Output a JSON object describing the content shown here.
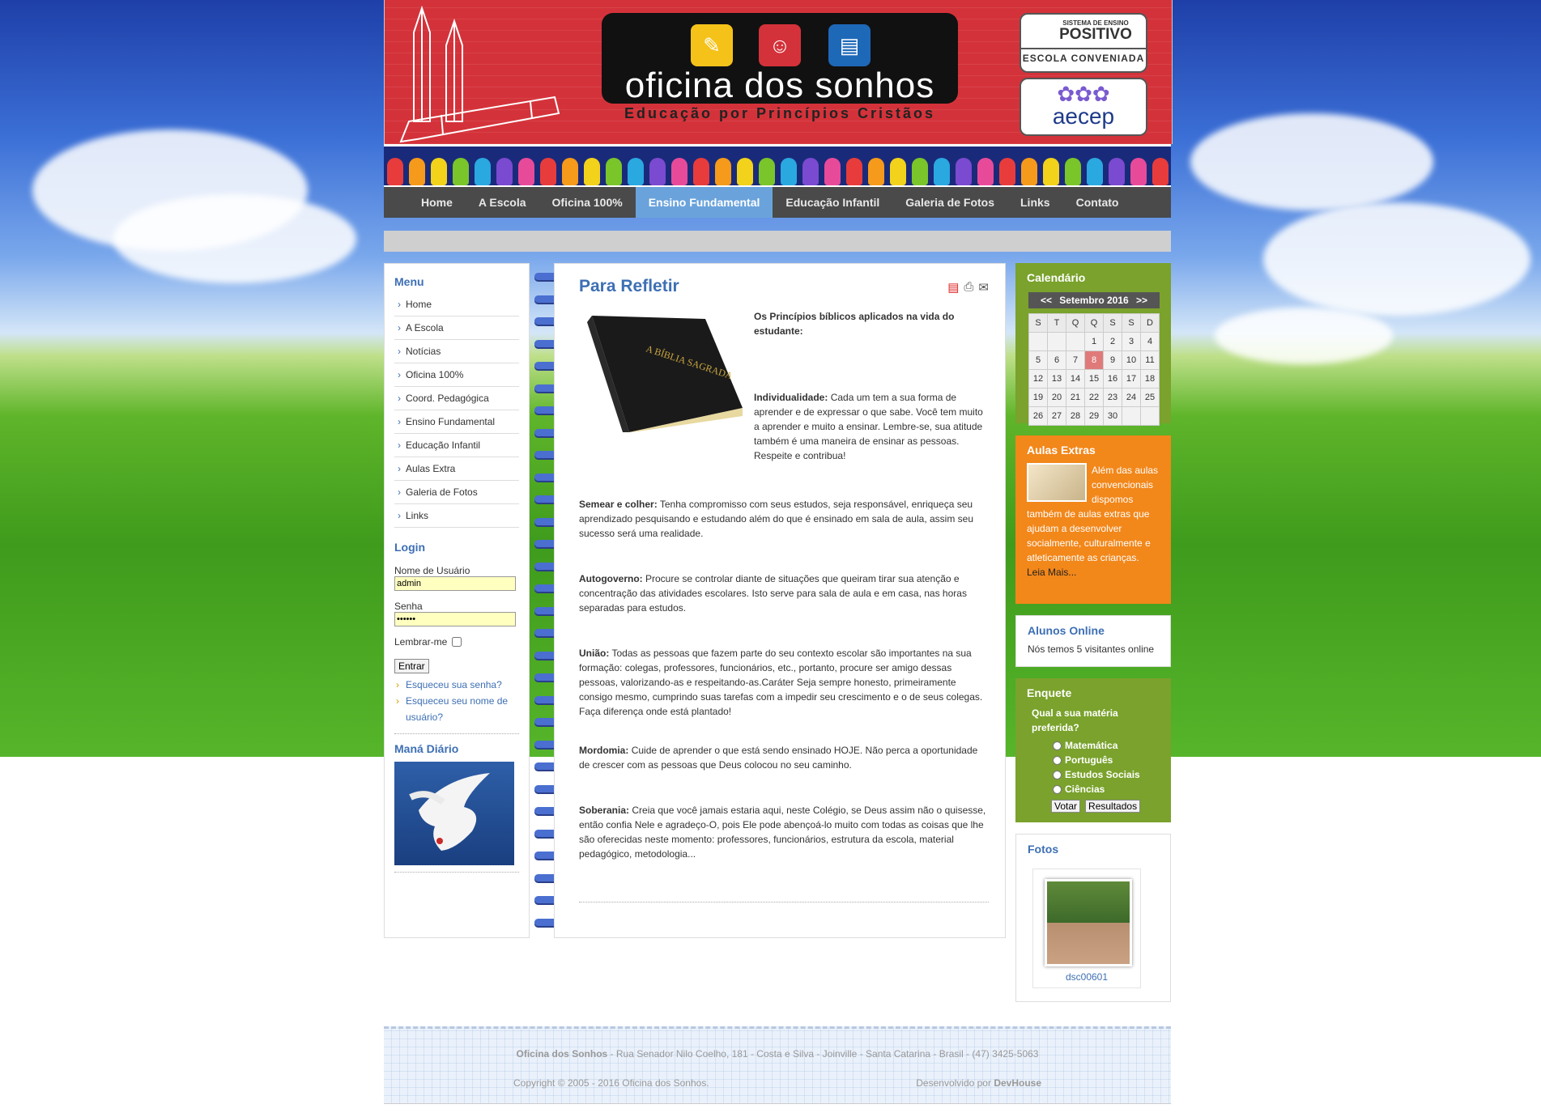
{
  "header": {
    "logo_title": "oficina dos sonhos",
    "logo_subtitle": "Educação por Princípios Cristãos",
    "badge1_top": "SISTEMA DE ENSINO",
    "badge1_brand": "POSITIVO",
    "badge1_bottom": "ESCOLA CONVENIADA",
    "badge2_brand": "aecep"
  },
  "nav": [
    "Home",
    "A Escola",
    "Oficina 100%",
    "Ensino Fundamental",
    "Educação Infantil",
    "Galeria de Fotos",
    "Links",
    "Contato"
  ],
  "nav_active": "Ensino Fundamental",
  "left": {
    "menu_title": "Menu",
    "menu_items": [
      "Home",
      "A Escola",
      "Notícias",
      "Oficina 100%",
      "Coord. Pedagógica",
      "Ensino Fundamental",
      "Educação Infantil",
      "Aulas Extra",
      "Galeria de Fotos",
      "Links"
    ],
    "login_title": "Login",
    "username_label": "Nome de Usuário",
    "username_value": "admin",
    "password_label": "Senha",
    "password_value": "••••••",
    "remember_label": "Lembrar-me",
    "login_button": "Entrar",
    "forgot_password": "Esqueceu sua senha?",
    "forgot_username": "Esqueceu seu nome de usuário?",
    "mana_title": "Maná Diário"
  },
  "article": {
    "title": "Para Refletir",
    "intro": "Os Princípios bíblicos aplicados na vida do estudante:",
    "book_label": "A BÍBLIA SAGRADA",
    "sections": [
      {
        "heading": "Individualidade:",
        "text": "Cada um tem a sua forma de aprender e de expressar o que sabe. Você tem muito a aprender e muito a ensinar. Lembre-se, sua atitude também é uma maneira de ensinar as pessoas. Respeite e contribua!"
      },
      {
        "heading": "Semear e colher:",
        "text": "Tenha compromisso com seus estudos, seja responsável, enriqueça seu aprendizado pesquisando e estudando além do que é ensinado em sala de aula, assim seu sucesso será uma realidade."
      },
      {
        "heading": "Autogoverno:",
        "text": "Procure se controlar diante de situações que queiram tirar sua atenção e concentração das atividades escolares. Isto serve para sala de aula e em casa, nas horas separadas para estudos."
      },
      {
        "heading": "União:",
        "text": "Todas as pessoas que fazem parte do seu contexto escolar são importantes na sua formação: colegas, professores, funcionários, etc., portanto, procure ser amigo dessas pessoas, valorizando-as e respeitando-as.Caráter Seja sempre honesto, primeiramente consigo mesmo, cumprindo suas tarefas com a impedir seu crescimento e o de seus colegas. Faça diferença onde está plantado!"
      },
      {
        "heading": "Mordomia:",
        "text": "Cuide de aprender o que está sendo ensinado HOJE. Não perca a oportunidade de crescer com as pessoas que Deus colocou no seu caminho."
      },
      {
        "heading": "Soberania:",
        "text": "Creia que você jamais estaria aqui, neste Colégio, se Deus assim não o quisesse, então confia Nele e agradeço-O, pois Ele pode abençoá-lo muito com todas as coisas que lhe são oferecidas neste momento: professores, funcionários, estrutura da escola, material pedagógico, metodologia..."
      }
    ]
  },
  "calendar": {
    "title": "Calendário",
    "prev": "<<",
    "next": ">>",
    "month": "Setembro 2016",
    "weekdays": [
      "S",
      "T",
      "Q",
      "Q",
      "S",
      "S",
      "D"
    ],
    "weeks": [
      [
        "",
        "",
        "",
        "1",
        "2",
        "3",
        "4"
      ],
      [
        "5",
        "6",
        "7",
        "8",
        "9",
        "10",
        "11"
      ],
      [
        "12",
        "13",
        "14",
        "15",
        "16",
        "17",
        "18"
      ],
      [
        "19",
        "20",
        "21",
        "22",
        "23",
        "24",
        "25"
      ],
      [
        "26",
        "27",
        "28",
        "29",
        "30",
        "",
        ""
      ]
    ],
    "today": "8"
  },
  "extras": {
    "title": "Aulas Extras",
    "text": "Além das aulas convencionais dispomos também de aulas extras que ajudam a desenvolver socialmente, culturalmente e atleticamente as crianças.",
    "more": "Leia Mais..."
  },
  "online": {
    "title": "Alunos Online",
    "text": "Nós temos 5 visitantes online"
  },
  "poll": {
    "title": "Enquete",
    "question": "Qual a sua matéria preferida?",
    "options": [
      "Matemática",
      "Português",
      "Estudos Sociais",
      "Ciências"
    ],
    "vote_button": "Votar",
    "results_button": "Resultados"
  },
  "photos": {
    "title": "Fotos",
    "caption": "dsc00601"
  },
  "footer": {
    "name": "Oficina dos Sonhos",
    "address": " - Rua Senador Nilo Coelho, 181 - Costa e Silva - Joinville - Santa Catarina - Brasil - (47) 3425-5063",
    "copyright": "Copyright © 2005 - 2016 Oficina dos Sonhos.",
    "dev_prefix": "Desenvolvido por ",
    "dev_name": "DevHouse"
  },
  "colors": {
    "header_red": "#d4323a",
    "link_blue": "#3d6fb4",
    "box_green": "#7aa22c",
    "box_orange": "#f2871a",
    "today_red": "#e07a7a"
  }
}
